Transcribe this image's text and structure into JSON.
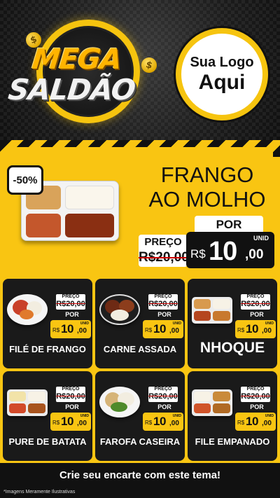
{
  "header": {
    "title_line1": "MEGA",
    "title_line2": "SALDÃO",
    "coin_symbol": "$",
    "logo_line1": "Sua Logo",
    "logo_line2": "Aqui"
  },
  "hero": {
    "discount": "-50%",
    "title_line1": "FRANGO",
    "title_line2": "AO MOLHO",
    "por_label": "POR",
    "preco_label": "PREÇO",
    "old_price": "R$20,00",
    "unid_label": "UNID",
    "currency": "R$",
    "price_int": "10",
    "price_dec": ",00"
  },
  "products": [
    {
      "name": "FILÉ DE FRANGO",
      "preco_label": "PREÇO",
      "old_price": "R$20,00",
      "por_label": "POR",
      "unid_label": "UNID",
      "currency": "R$",
      "price_int": "10",
      "price_dec": ",00"
    },
    {
      "name": "CARNE ASSADA",
      "preco_label": "PREÇO",
      "old_price": "R$20,00",
      "por_label": "POR",
      "unid_label": "UNID",
      "currency": "R$",
      "price_int": "10",
      "price_dec": ",00"
    },
    {
      "name": "NHOQUE",
      "preco_label": "PREÇO",
      "old_price": "R$20,00",
      "por_label": "POR",
      "unid_label": "UNID",
      "currency": "R$",
      "price_int": "10",
      "price_dec": ",00"
    },
    {
      "name": "PURE DE BATATA",
      "preco_label": "PREÇO",
      "old_price": "R$20,00",
      "por_label": "POR",
      "unid_label": "UNID",
      "currency": "R$",
      "price_int": "10",
      "price_dec": ",00"
    },
    {
      "name": "FAROFA CASEIRA",
      "preco_label": "PREÇO",
      "old_price": "R$20,00",
      "por_label": "POR",
      "unid_label": "UNID",
      "currency": "R$",
      "price_int": "10",
      "price_dec": ",00"
    },
    {
      "name": "FILE EMPANADO",
      "preco_label": "PREÇO",
      "old_price": "R$20,00",
      "por_label": "POR",
      "unid_label": "UNID",
      "currency": "R$",
      "price_int": "10",
      "price_dec": ",00"
    }
  ],
  "footer": {
    "cta": "Crie seu encarte com este tema!",
    "disclaimer": "*Imagens Meramente Ilustrativas"
  },
  "colors": {
    "accent_yellow": "#f9c512",
    "dark": "#1a1a1a",
    "strike_red": "#cc0000"
  }
}
